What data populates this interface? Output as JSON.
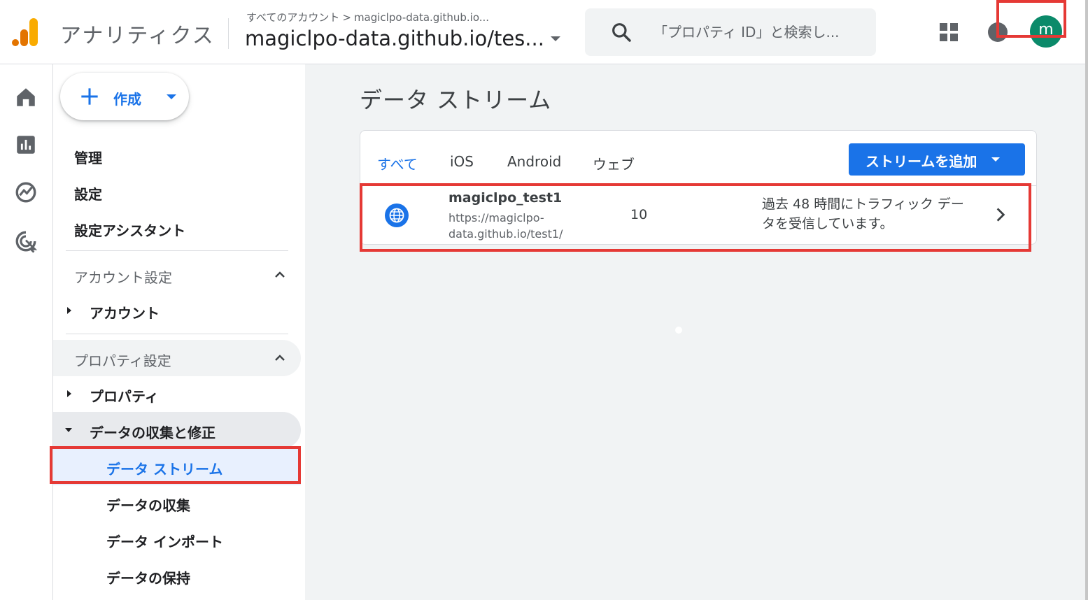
{
  "header": {
    "app_name": "アナリティクス",
    "breadcrumb_root": "すべてのアカウント",
    "breadcrumb_sep": ">",
    "breadcrumb_account": "magiclpo-data.github.io...",
    "property_title": "magiclpo-data.github.io/tes...",
    "search_placeholder": "「プロパティ ID」と検索し...",
    "avatar_letter": "m",
    "avatar_color": "#0b8a6a"
  },
  "sidebar": {
    "create_label": "作成",
    "items": {
      "admin": "管理",
      "settings": "設定",
      "setup_assistant": "設定アシスタント",
      "account_settings": "アカウント設定",
      "account": "アカウント",
      "property_settings": "プロパティ設定",
      "property": "プロパティ",
      "data_collection_modification": "データの収集と修正",
      "data_streams": "データ ストリーム",
      "data_collection": "データの収集",
      "data_import": "データ インポート",
      "data_retention": "データの保持"
    }
  },
  "main": {
    "page_title": "データ ストリーム",
    "tabs": [
      "すべて",
      "iOS",
      "Android",
      "ウェブ"
    ],
    "add_stream_label": "ストリームを追加",
    "streams": [
      {
        "name": "magiclpo_test1",
        "url": "https://magiclpo-data.github.io/test1/",
        "id": "10",
        "status": "過去 48 時間にトラフィック データを受信しています。"
      }
    ]
  },
  "colors": {
    "accent": "#1a73e8",
    "highlight": "#e53935"
  }
}
